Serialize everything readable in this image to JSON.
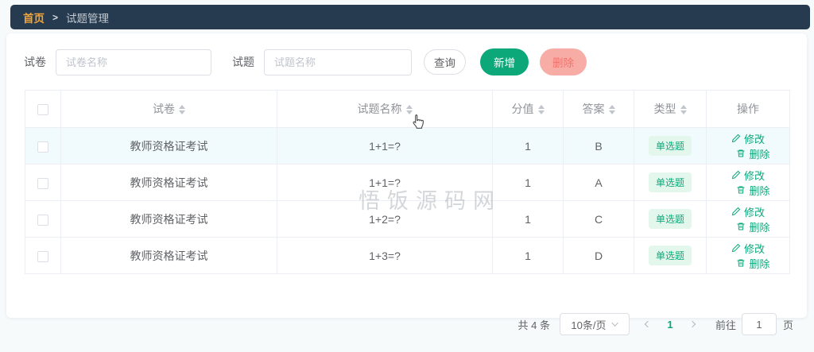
{
  "breadcrumb": {
    "home": "首页",
    "separator": ">",
    "current": "试题管理"
  },
  "search": {
    "paper_label": "试卷",
    "paper_placeholder": "试卷名称",
    "question_label": "试题",
    "question_placeholder": "试题名称",
    "query_button": "查询",
    "add_button": "新增",
    "delete_button": "删除"
  },
  "table": {
    "headers": [
      "试卷",
      "试题名称",
      "分值",
      "答案",
      "类型",
      "操作"
    ],
    "actions": {
      "edit": "修改",
      "delete": "删除"
    },
    "rows": [
      {
        "paper": "教师资格证考试",
        "question": "1+1=?",
        "score": "1",
        "answer": "B",
        "type": "单选题"
      },
      {
        "paper": "教师资格证考试",
        "question": "1+1=?",
        "score": "1",
        "answer": "A",
        "type": "单选题"
      },
      {
        "paper": "教师资格证考试",
        "question": "1+2=?",
        "score": "1",
        "answer": "C",
        "type": "单选题"
      },
      {
        "paper": "教师资格证考试",
        "question": "1+3=?",
        "score": "1",
        "answer": "D",
        "type": "单选题"
      }
    ]
  },
  "pagination": {
    "total": "共 4 条",
    "page_size": "10条/页",
    "current_page": "1",
    "goto_label": "前往",
    "goto_value": "1",
    "page_unit": "页"
  },
  "watermark": "悟饭源码网",
  "colors": {
    "navbar_bg": "#263b50",
    "breadcrumb_active": "#f0a43b",
    "primary_green": "#0ca87a",
    "danger_pink": "#f8aca6",
    "badge_bg": "#e3f7ec",
    "row_hover": "#f1fafd"
  }
}
